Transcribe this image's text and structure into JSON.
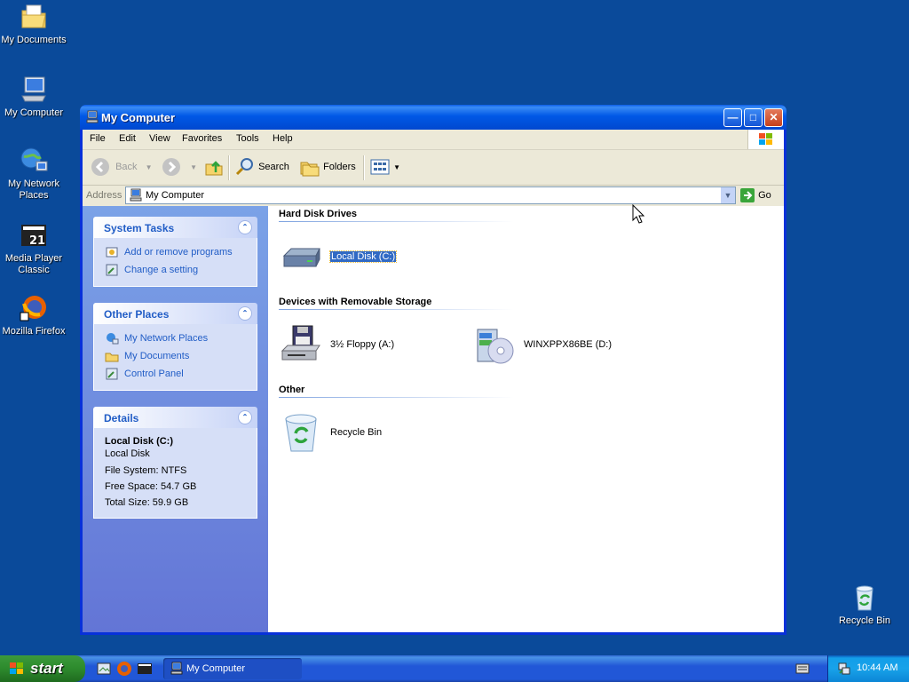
{
  "desktop": {
    "icons": [
      {
        "label": "My Documents"
      },
      {
        "label": "My Computer"
      },
      {
        "label": "My Network Places"
      },
      {
        "label": "Media Player Classic"
      },
      {
        "label": "Mozilla Firefox"
      },
      {
        "label": "Recycle Bin"
      }
    ]
  },
  "window": {
    "title": "My Computer",
    "menu": [
      "File",
      "Edit",
      "View",
      "Favorites",
      "Tools",
      "Help"
    ],
    "toolbar": {
      "back": "Back",
      "search": "Search",
      "folders": "Folders"
    },
    "address": {
      "label": "Address",
      "value": "My Computer",
      "go": "Go"
    },
    "taskpane": {
      "system_tasks": {
        "title": "System Tasks",
        "items": [
          "Add or remove programs",
          "Change a setting"
        ]
      },
      "other_places": {
        "title": "Other Places",
        "items": [
          "My Network Places",
          "My Documents",
          "Control Panel"
        ]
      },
      "details": {
        "title": "Details",
        "name": "Local Disk (C:)",
        "type": "Local Disk",
        "file_system": "File System: NTFS",
        "free_space": "Free Space: 54.7 GB",
        "total_size": "Total Size: 59.9 GB"
      }
    },
    "groups": {
      "hard_disk": {
        "title": "Hard Disk Drives",
        "items": [
          "Local Disk (C:)"
        ]
      },
      "removable": {
        "title": "Devices with Removable Storage",
        "items": [
          "3½ Floppy (A:)",
          "WINXPPX86BE (D:)"
        ]
      },
      "other": {
        "title": "Other",
        "items": [
          "Recycle Bin"
        ]
      }
    }
  },
  "taskbar": {
    "start": "start",
    "task": "My Computer",
    "clock": "10:44 AM"
  },
  "colors": {
    "desktop": "#0a4a9a",
    "title_blue": "#0058e6",
    "link_blue": "#215dc6",
    "selection": "#316ac5",
    "start_green": "#2d8a2d"
  }
}
